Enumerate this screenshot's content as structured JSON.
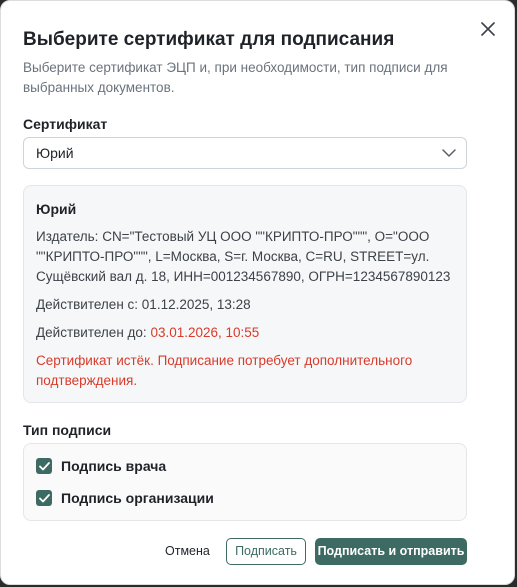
{
  "dialog": {
    "title": "Выберите сертификат для подписания",
    "subtitle": "Выберите сертификат ЭЦП и, при необходимости, тип подписи для выбранных документов.",
    "close_icon": "close-icon"
  },
  "certificate": {
    "label": "Сертификат",
    "selected": "Юрий",
    "dropdown_icon": "chevron-down-icon"
  },
  "cert_details": {
    "name": "Юрий",
    "issuer": "Издатель: CN=\"Тестовый УЦ ООО \"\"КРИПТО-ПРО\"\"\", O=\"ООО \"\"КРИПТО-ПРО\"\"\", L=Москва, S=г. Москва, C=RU, STREET=ул. Сущёвский вал д. 18, ИНН=001234567890, ОГРН=1234567890123",
    "valid_from_label": "Действителен с:",
    "valid_from": "01.12.2025, 13:28",
    "valid_to_label": "Действителен до:",
    "valid_to": "03.01.2026, 10:55",
    "warning": "Сертификат истёк. Подписание потребует дополнительного подтверждения.",
    "warning_color": "#d93b2b"
  },
  "signature_type": {
    "label": "Тип подписи",
    "options": [
      {
        "label": "Подпись врача",
        "checked": true
      },
      {
        "label": "Подпись организации",
        "checked": true
      }
    ],
    "accent_color": "#3d6b63"
  },
  "footer": {
    "cancel_label": "Отмена",
    "sign_label": "Подписать",
    "sign_send_label": "Подписать и отправить"
  }
}
